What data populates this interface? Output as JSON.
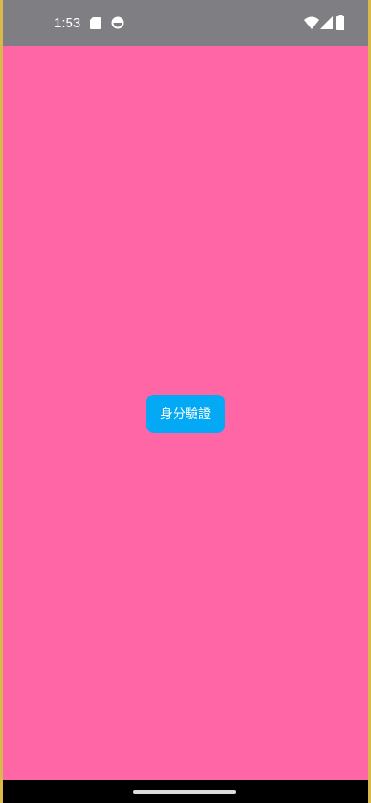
{
  "status_bar": {
    "time": "1:53",
    "icons": [
      "sd-card-icon",
      "sync-icon",
      "wifi-icon",
      "cell-signal-icon",
      "battery-icon"
    ],
    "background_color": "#7f7e82"
  },
  "screen": {
    "background_color": "#ff66a6"
  },
  "auth_button": {
    "label": "身分驗證",
    "background_color": "#03a9f4",
    "text_color": "#ffffff"
  },
  "navigation_bar": {
    "gesture_handle": "home-gesture-handle"
  }
}
